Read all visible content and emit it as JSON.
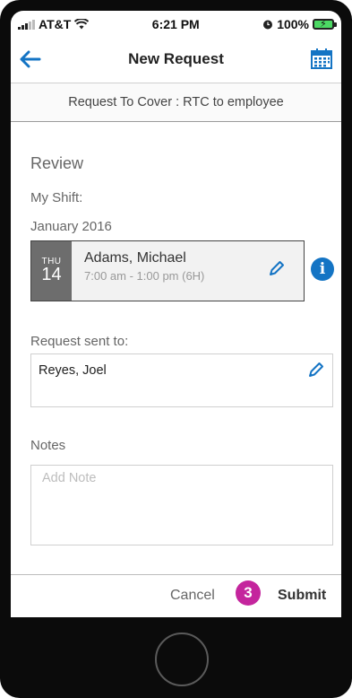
{
  "status_bar": {
    "carrier": "AT&T",
    "time": "6:21 PM",
    "battery": "100%",
    "icons": [
      "signal-bars-icon",
      "wifi-icon",
      "alarm-icon",
      "battery-charging-icon"
    ]
  },
  "nav": {
    "title": "New Request",
    "back_icon": "back-arrow-icon",
    "calendar_icon": "calendar-icon"
  },
  "sub_header": "Request To Cover : RTC to employee",
  "review": {
    "title": "Review",
    "my_shift_label": "My Shift:",
    "month": "January 2016",
    "shift": {
      "day_of_week": "THU",
      "day": "14",
      "name": "Adams, Michael",
      "time": "7:00 am - 1:00 pm (6H)"
    }
  },
  "request": {
    "label": "Request sent to:",
    "value": "Reyes, Joel"
  },
  "notes": {
    "label": "Notes",
    "placeholder": "Add Note"
  },
  "footer": {
    "cancel_label": "Cancel",
    "step_number": "3",
    "submit_label": "Submit"
  },
  "colors": {
    "accent_blue": "#1474c4",
    "step_badge": "#c4259d",
    "date_block": "#6d6d6d"
  }
}
